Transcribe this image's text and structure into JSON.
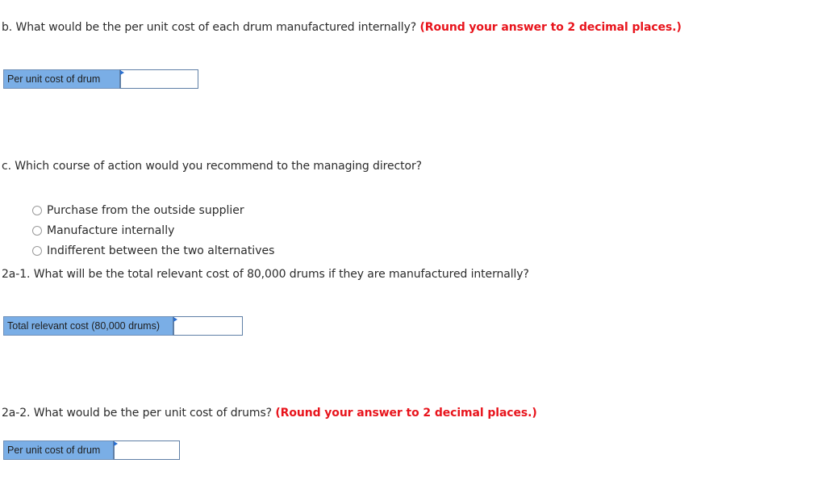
{
  "part_b": {
    "question": "b. What would be the per unit cost of each drum manufactured internally?",
    "hint": "(Round your answer to 2 decimal places.)",
    "field_label": "Per unit cost of drum",
    "field_value": ""
  },
  "part_c": {
    "question": "c. Which course of action would you recommend to the managing director?",
    "options": [
      {
        "label": "Purchase from the outside supplier",
        "selected": false
      },
      {
        "label": "Manufacture internally",
        "selected": false
      },
      {
        "label": "Indifferent between the two alternatives",
        "selected": false
      }
    ]
  },
  "part_2a1": {
    "question": "2a-1. What will be the total relevant cost of 80,000 drums if they are manufactured internally?",
    "field_label": "Total relevant cost (80,000  drums)",
    "field_value": ""
  },
  "part_2a2": {
    "question": "2a-2. What would be the per unit cost of drums?",
    "hint": "(Round your answer to 2 decimal places.)",
    "field_label": "Per unit cost of drum",
    "field_value": ""
  }
}
